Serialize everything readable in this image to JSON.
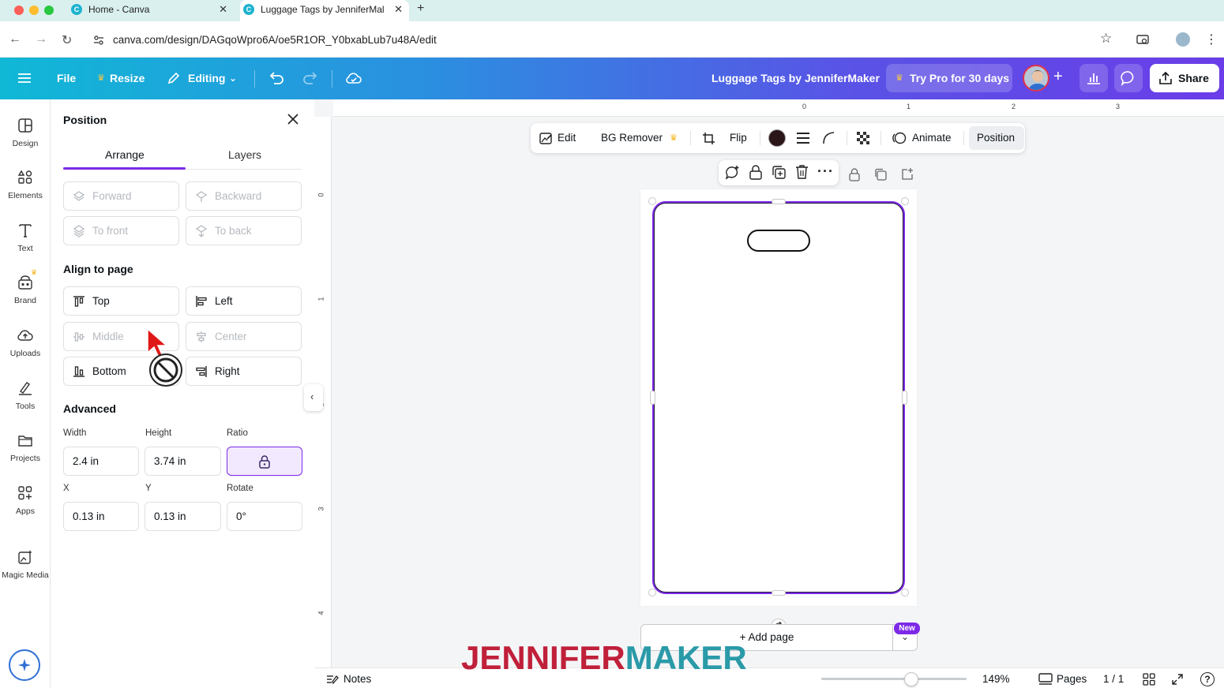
{
  "browser": {
    "tabs": [
      {
        "title": "Home - Canva",
        "active": false
      },
      {
        "title": "Luggage Tags by JenniferMal",
        "active": true
      }
    ],
    "url": "canva.com/design/DAGqoWpro6A/oe5R1OR_Y0bxabLub7u48A/edit"
  },
  "header": {
    "file": "File",
    "resize": "Resize",
    "editing": "Editing",
    "doc_title": "Luggage Tags by JenniferMaker",
    "try_pro": "Try Pro for 30 days",
    "share": "Share"
  },
  "rail": [
    {
      "label": "Design",
      "icon": "design-icon"
    },
    {
      "label": "Elements",
      "icon": "elements-icon"
    },
    {
      "label": "Text",
      "icon": "text-icon"
    },
    {
      "label": "Brand",
      "icon": "brand-icon"
    },
    {
      "label": "Uploads",
      "icon": "uploads-icon"
    },
    {
      "label": "Tools",
      "icon": "tools-icon"
    },
    {
      "label": "Projects",
      "icon": "projects-icon"
    },
    {
      "label": "Apps",
      "icon": "apps-icon"
    },
    {
      "label": "Magic Media",
      "icon": "magic-media-icon"
    }
  ],
  "panel": {
    "title": "Position",
    "tabs": {
      "arrange": "Arrange",
      "layers": "Layers"
    },
    "order": {
      "forward": "Forward",
      "backward": "Backward",
      "to_front": "To front",
      "to_back": "To back"
    },
    "align_title": "Align to page",
    "align": {
      "top": "Top",
      "left": "Left",
      "middle": "Middle",
      "center": "Center",
      "bottom": "Bottom",
      "right": "Right"
    },
    "advanced_title": "Advanced",
    "labels": {
      "width": "Width",
      "height": "Height",
      "ratio": "Ratio",
      "x": "X",
      "y": "Y",
      "rotate": "Rotate"
    },
    "values": {
      "width": "2.4 in",
      "height": "3.74 in",
      "x": "0.13 in",
      "y": "0.13 in",
      "rotate": "0°"
    }
  },
  "toolbar": {
    "edit": "Edit",
    "bg_remover": "BG Remover",
    "flip": "Flip",
    "animate": "Animate",
    "position": "Position",
    "color": "#2a1518"
  },
  "ruler": {
    "top": [
      "0",
      "1",
      "2",
      "3"
    ],
    "left": [
      "0",
      "1",
      "2",
      "3",
      "4"
    ]
  },
  "canvas": {
    "add_page": "+ Add page",
    "new_badge": "New"
  },
  "footer": {
    "notes": "Notes",
    "zoom": "149%",
    "pages": "Pages",
    "page_count": "1 / 1",
    "zoom_level": 0.62
  },
  "watermark": {
    "part1": "JENNIFER",
    "part2": "MAKER"
  },
  "colors": {
    "accent": "#7d2ae8",
    "header_start": "#10b8d6",
    "header_end": "#6a3de8"
  }
}
